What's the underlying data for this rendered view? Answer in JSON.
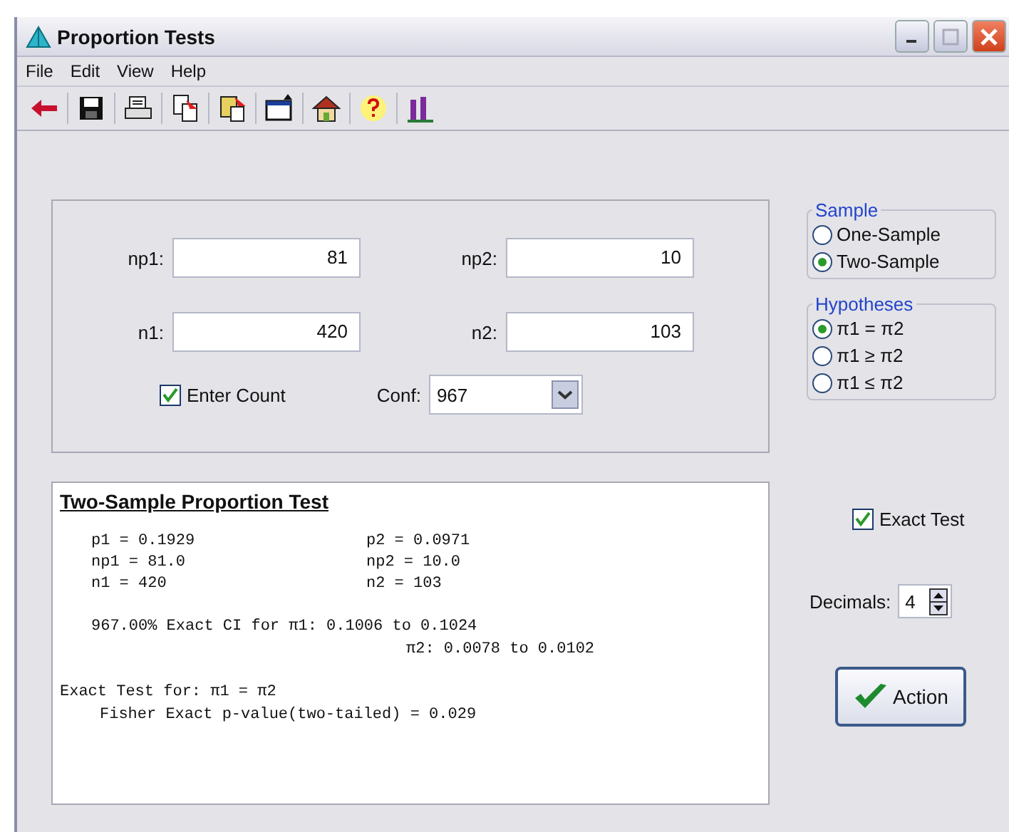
{
  "window": {
    "title": "Proportion Tests"
  },
  "menu": [
    "File",
    "Edit",
    "View",
    "Help"
  ],
  "inputs": [
    {
      "label": "np1:",
      "value": "81"
    },
    {
      "label": "np2:",
      "value": "10"
    },
    {
      "label": "n1:",
      "value": "420"
    },
    {
      "label": "n2:",
      "value": "103"
    }
  ],
  "enter_count": {
    "label": "Enter Count",
    "checked": true
  },
  "conf": {
    "label": "Conf:",
    "value": "967"
  },
  "sample": {
    "title": "Sample",
    "options": [
      {
        "label": "One-Sample",
        "selected": false
      },
      {
        "label": "Two-Sample",
        "selected": true
      }
    ]
  },
  "hypotheses": {
    "title": "Hypotheses",
    "options": [
      {
        "label": "π1 = π2",
        "selected": true
      },
      {
        "label": "π1 ≥ π2",
        "selected": false
      },
      {
        "label": "π1 ≤ π2",
        "selected": false
      }
    ]
  },
  "results": {
    "title": "Two-Sample Proportion Test",
    "stats": [
      {
        "left": "p1 = 0.1929",
        "right": "p2 = 0.0971"
      },
      {
        "left": "np1 = 81.0",
        "right": "np2 = 10.0"
      },
      {
        "left": "n1 = 420",
        "right": "n2 = 103"
      }
    ],
    "ci": [
      "967.00% Exact CI for π1: 0.1006 to 0.1024",
      "π2: 0.0078 to 0.0102"
    ],
    "test": [
      "Exact Test for: π1 = π2",
      "Fisher Exact p-value(two-tailed) = 0.029"
    ]
  },
  "exact_test": {
    "label": "Exact Test",
    "checked": true
  },
  "decimals": {
    "label": "Decimals:",
    "value": "4"
  },
  "action_button": "Action"
}
